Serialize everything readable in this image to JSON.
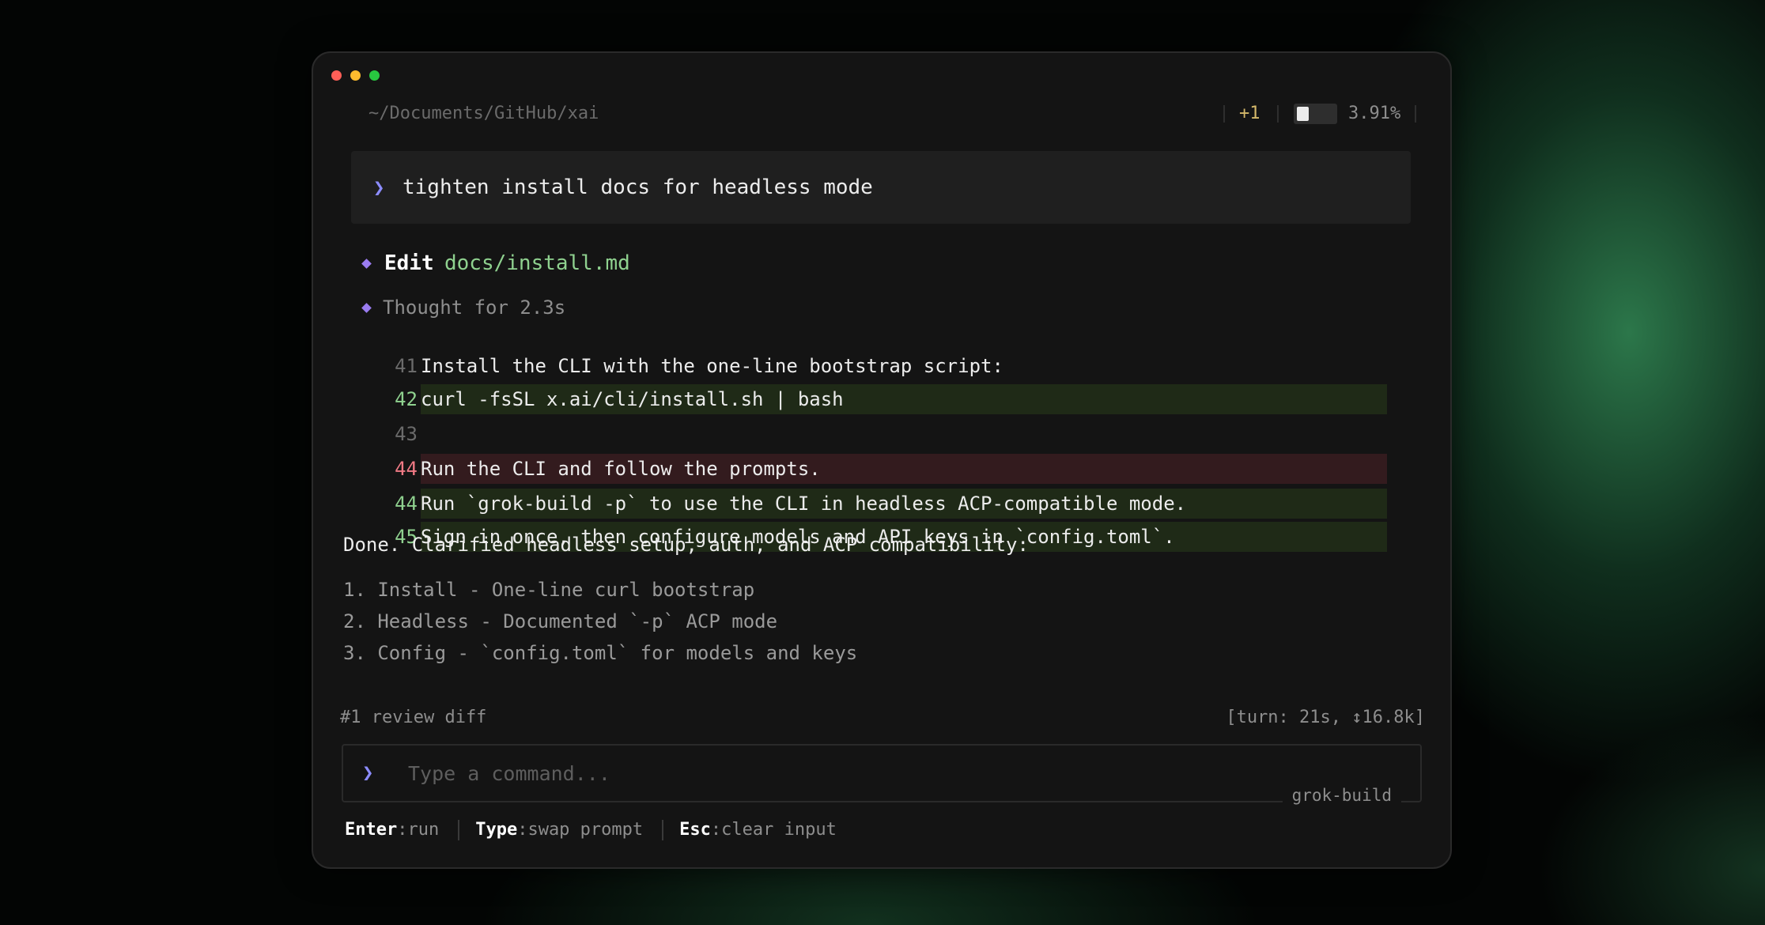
{
  "header": {
    "path": "~/Documents/GitHub/xai",
    "change_count": "+1",
    "context_fraction": 0.0391,
    "context_percent": "3.91%"
  },
  "prompt": {
    "chevron": "❯",
    "text": "tighten install docs for headless mode"
  },
  "edit": {
    "label": "Edit",
    "file": "docs/install.md"
  },
  "thought": "Thought for 2.3s",
  "diff": [
    {
      "line": "41",
      "type": "context",
      "text": "Install the CLI with the one-line bootstrap script:"
    },
    {
      "line": "42",
      "type": "added",
      "text": "curl -fsSL x.ai/cli/install.sh | bash"
    },
    {
      "line": "43",
      "type": "context",
      "text": ""
    },
    {
      "line": "44",
      "type": "removed",
      "text": "Run the CLI and follow the prompts."
    },
    {
      "line": "44",
      "type": "added",
      "text": "Run `grok-build -p` to use the CLI in headless ACP-compatible mode."
    },
    {
      "line": "45",
      "type": "added",
      "text": "Sign in once, then configure models and API keys in `config.toml`."
    }
  ],
  "summary": {
    "intro": "Done. Clarified headless setup, auth, and ACP compatibility:",
    "items": [
      "1. Install - One-line curl bootstrap",
      "2. Headless - Documented `-p` ACP mode",
      "3. Config - `config.toml` for models and keys"
    ]
  },
  "status": {
    "left": "#1 review diff",
    "right": "[turn: 21s, ↕16.8k]"
  },
  "input": {
    "chevron": "❯",
    "placeholder": "Type a command...",
    "value": "",
    "brand": "grok-build"
  },
  "hints": [
    {
      "key": "Enter",
      "desc": ":run"
    },
    {
      "key": "Type",
      "desc": ":swap prompt"
    },
    {
      "key": "Esc",
      "desc": ":clear input"
    }
  ],
  "colors": {
    "accent_chevron": "#8c8cff",
    "diamond": "#9a7cf0",
    "added_line_number": "#8fd18f",
    "removed_line_number": "#f07a85",
    "added_bg": "#1f2a17",
    "removed_bg": "#331b1e",
    "change_count": "#d4b86a"
  }
}
